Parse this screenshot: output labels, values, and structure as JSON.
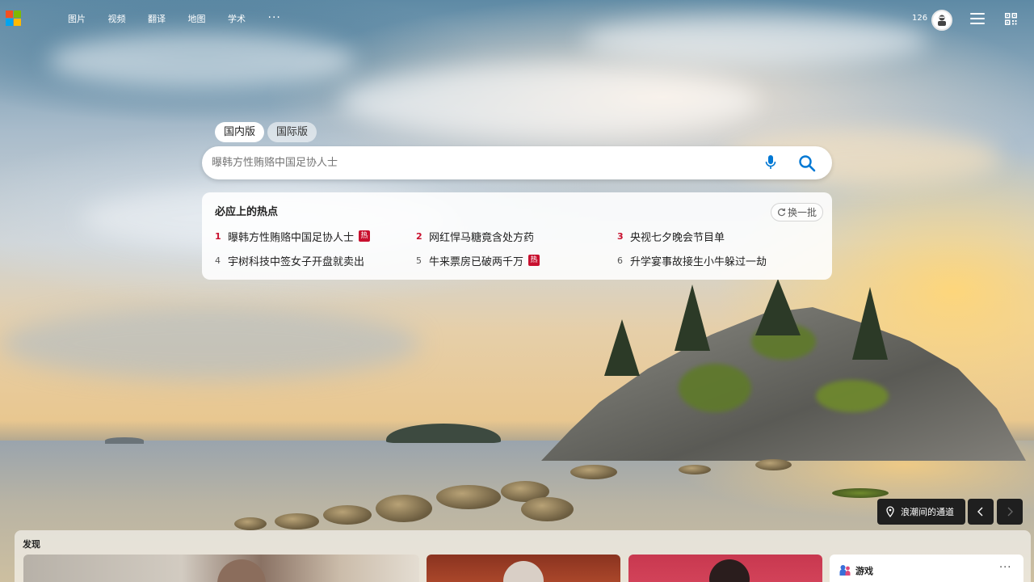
{
  "nav": {
    "items": [
      "图片",
      "视频",
      "翻译",
      "地图",
      "学术"
    ],
    "more": "···"
  },
  "user": {
    "points": "126"
  },
  "search": {
    "tabs": [
      "国内版",
      "国际版"
    ],
    "active_tab": "国内版",
    "placeholder": "曝韩方性贿赂中国足协人士"
  },
  "hot": {
    "title": "必应上的热点",
    "refresh_label": "换一批",
    "items": [
      {
        "rank": "1",
        "text": "曝韩方性贿赂中国足协人士",
        "badge": "热"
      },
      {
        "rank": "2",
        "text": "网红悍马糖竟含处方药",
        "badge": ""
      },
      {
        "rank": "3",
        "text": "央视七夕晚会节目单",
        "badge": ""
      },
      {
        "rank": "4",
        "text": "宇树科技中签女子开盘就卖出",
        "badge": ""
      },
      {
        "rank": "5",
        "text": "牛来票房已破两千万",
        "badge": "热"
      },
      {
        "rank": "6",
        "text": "升学宴事故接生小牛躲过一劫",
        "badge": ""
      }
    ]
  },
  "location": {
    "label": "浪潮间的通道"
  },
  "discover": {
    "title": "发现",
    "games_label": "游戏",
    "games_more": "···"
  },
  "colors": {
    "logo": [
      "#f25022",
      "#7fba00",
      "#00a4ef",
      "#ffb900"
    ],
    "hot_red": "#c8102e",
    "search_icon": "#0078d4"
  }
}
